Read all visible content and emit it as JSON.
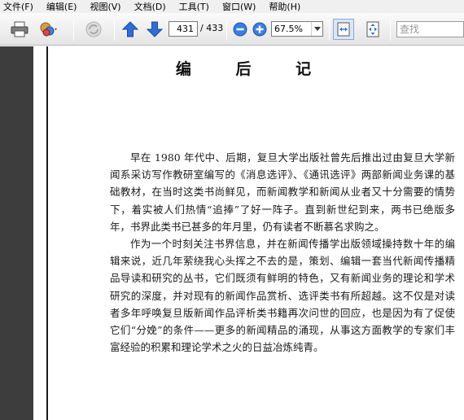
{
  "menu": [
    {
      "label": "文件(F)"
    },
    {
      "label": "编辑(E)"
    },
    {
      "label": "视图(V)"
    },
    {
      "label": "文档(D)"
    },
    {
      "label": "工具(T)"
    },
    {
      "label": "窗口(W)"
    },
    {
      "label": "帮助(H)"
    }
  ],
  "toolbar": {
    "current_page": "431",
    "page_total": "/ 433",
    "zoom": "67.5%",
    "search_placeholder": "查找"
  },
  "icons": {
    "print": "printer-icon",
    "share": "share-icon",
    "disabled": "sync-icon",
    "prev": "arrow-up-icon",
    "next": "arrow-down-icon",
    "zoom_out": "minus-circle-icon",
    "zoom_in": "plus-circle-icon",
    "fit_width": "fit-width-icon",
    "fit_page": "fit-page-icon"
  },
  "colors": {
    "accent_blue": "#2f6fd4",
    "sidebar": "#3d3d3d"
  },
  "document": {
    "title": "编  后  记",
    "paragraphs": [
      "早在 1980 年代中、后期，复旦大学出版社曾先后推出过由复旦大学新闻系采访写作教研室编写的《消息选评》、《通讯选评》两部新闻业务课的基础教材，在当时这类书尚鲜见，而新闻教学和新闻从业者又十分需要的情势下，着实被人们热情“追捧”了好一阵子。直到新世纪到来，两书已绝版多年，书界此类书已甚多的年月里，仍有读者不断慕名求购之。",
      "作为一个时刻关注书界信息，并在新闻传播学出版领域操持数十年的编辑来说，近几年萦绕我心头挥之不去的是，策划、编辑一套当代新闻传播精品导读和研究的丛书，它们既须有鲜明的特色，又有新闻业务的理论和学术研究的深度，并对现有的新闻作品赏析、选评类书有所超越。这不仅是对读者多年呼唤复旦版新闻作品评析类书籍再次问世的回应，也是因为有了促使它们“分娩”的条件——更多的新闻精品的涌现，从事这方面教学的专家们丰富经验的积累和理论学术之火的日益冶炼纯青。"
    ]
  }
}
